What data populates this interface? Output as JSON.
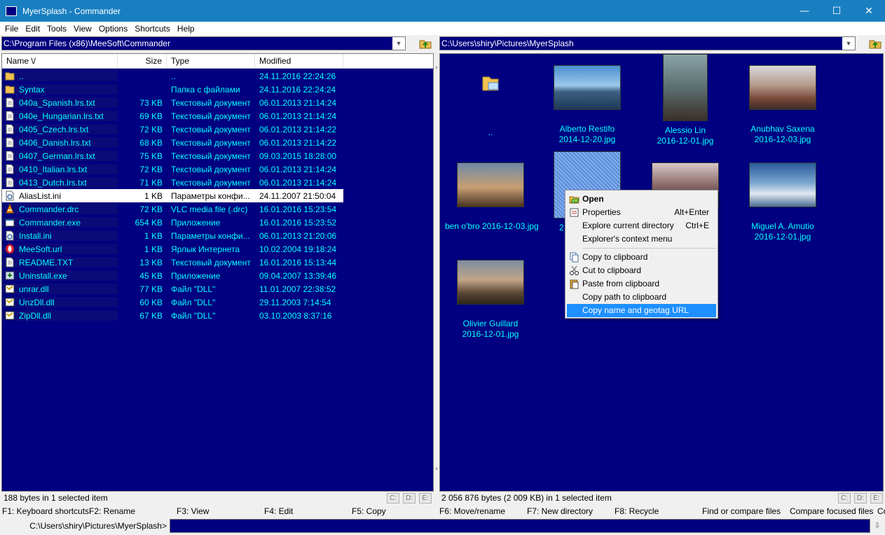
{
  "window": {
    "title": "MyerSplash - Commander",
    "minimize": "—",
    "maximize": "☐",
    "close": "✕"
  },
  "menu": [
    "File",
    "Edit",
    "Tools",
    "View",
    "Options",
    "Shortcuts",
    "Help"
  ],
  "left": {
    "path": "C:\\Program Files (x86)\\MeeSoft\\Commander",
    "columns": {
      "name": "Name \\/",
      "size": "Size",
      "type": "Type",
      "modified": "Modified"
    },
    "rows": [
      {
        "icon": "folder-up-icon",
        "name": "..",
        "size": "",
        "type": "..",
        "modified": "24.11.2016 22:24:26"
      },
      {
        "icon": "folder-icon",
        "name": "Syntax",
        "size": "",
        "type": "Папка с файлами",
        "modified": "24.11.2016 22:24:24"
      },
      {
        "icon": "text-file-icon",
        "name": "040a_Spanish.lrs.txt",
        "size": "73 KB",
        "type": "Текстовый документ",
        "modified": "06.01.2013 21:14:24"
      },
      {
        "icon": "text-file-icon",
        "name": "040e_Hungarian.lrs.txt",
        "size": "69 KB",
        "type": "Текстовый документ",
        "modified": "06.01.2013 21:14:24"
      },
      {
        "icon": "text-file-icon",
        "name": "0405_Czech.lrs.txt",
        "size": "72 KB",
        "type": "Текстовый документ",
        "modified": "06.01.2013 21:14:22"
      },
      {
        "icon": "text-file-icon",
        "name": "0406_Danish.lrs.txt",
        "size": "68 KB",
        "type": "Текстовый документ",
        "modified": "06.01.2013 21:14:22"
      },
      {
        "icon": "text-file-icon",
        "name": "0407_German.lrs.txt",
        "size": "75 KB",
        "type": "Текстовый документ",
        "modified": "09.03.2015 18:28:00"
      },
      {
        "icon": "text-file-icon",
        "name": "0410_Italian.lrs.txt",
        "size": "72 KB",
        "type": "Текстовый документ",
        "modified": "06.01.2013 21:14:24"
      },
      {
        "icon": "text-file-icon",
        "name": "0413_Dutch.lrs.txt",
        "size": "71 KB",
        "type": "Текстовый документ",
        "modified": "06.01.2013 21:14:24"
      },
      {
        "icon": "ini-file-icon",
        "name": "AliasList.ini",
        "size": "1 KB",
        "type": "Параметры конфи...",
        "modified": "24.11.2007 21:50:04",
        "selected": true
      },
      {
        "icon": "vlc-cone-icon",
        "name": "Commander.drc",
        "size": "72 KB",
        "type": "VLC media file (.drc)",
        "modified": "16.01.2016 15:23:54"
      },
      {
        "icon": "exe-icon",
        "name": "Commander.exe",
        "size": "654 KB",
        "type": "Приложение",
        "modified": "16.01.2016 15:23:52"
      },
      {
        "icon": "ini-file-icon",
        "name": "Install.ini",
        "size": "1 KB",
        "type": "Параметры конфи...",
        "modified": "06.01.2013 21:20:06"
      },
      {
        "icon": "opera-icon",
        "name": "MeeSoft.url",
        "size": "1 KB",
        "type": "Ярлык Интернета",
        "modified": "10.02.2004 19:18:24"
      },
      {
        "icon": "text-file-icon",
        "name": "README.TXT",
        "size": "13 KB",
        "type": "Текстовый документ",
        "modified": "16.01.2016 15:13:44"
      },
      {
        "icon": "installer-icon",
        "name": "Uninstall.exe",
        "size": "45 KB",
        "type": "Приложение",
        "modified": "09.04.2007 13:39:46"
      },
      {
        "icon": "dll-icon",
        "name": "unrar.dll",
        "size": "77 KB",
        "type": "Файл \"DLL\"",
        "modified": "11.01.2007 22:38:52"
      },
      {
        "icon": "dll-icon",
        "name": "UnzDll.dll",
        "size": "60 KB",
        "type": "Файл \"DLL\"",
        "modified": "29.11.2003 7:14:54"
      },
      {
        "icon": "dll-icon",
        "name": "ZipDll.dll",
        "size": "67 KB",
        "type": "Файл \"DLL\"",
        "modified": "03.10.2003 8:37:16"
      }
    ],
    "status": "188 bytes in 1 selected item",
    "drives": [
      "C:",
      "D:",
      "E:"
    ]
  },
  "right": {
    "path": "C:\\Users\\shiry\\Pictures\\MyerSplash",
    "thumbnails": [
      {
        "line1": "..",
        "line2": ""
      },
      {
        "line1": "Alberto Restifo",
        "line2": "2014-12-20.jpg"
      },
      {
        "line1": "Alessio Lin",
        "line2": "2016-12-01.jpg"
      },
      {
        "line1": "Anubhav Saxena",
        "line2": "2016-12-03.jpg"
      },
      {
        "line1": "ben o'bro  2016-12-03.jpg",
        "line2": ""
      },
      {
        "line1": "2",
        "line2": ""
      },
      {
        "line1": "",
        "line2": ""
      },
      {
        "line1": "Miguel A. Amutio",
        "line2": "2016-12-01.jpg"
      },
      {
        "line1": "Olivier Guillard",
        "line2": "2016-12-01.jpg"
      }
    ],
    "status": "2 056 876 bytes (2 009 KB) in 1 selected item",
    "drives": [
      "C:",
      "D:",
      "E:"
    ]
  },
  "context_menu": {
    "items": [
      {
        "label": "Open",
        "shortcut": ""
      },
      {
        "label": "Properties",
        "shortcut": "Alt+Enter"
      },
      {
        "label": "Explore current directory",
        "shortcut": "Ctrl+E"
      },
      {
        "label": "Explorer's context menu",
        "shortcut": ""
      },
      {
        "label": "Copy to clipboard",
        "shortcut": ""
      },
      {
        "label": "Cut to clipboard",
        "shortcut": ""
      },
      {
        "label": "Paste from clipboard",
        "shortcut": ""
      },
      {
        "label": "Copy path to clipboard",
        "shortcut": ""
      },
      {
        "label": "Copy name and geotag URL",
        "shortcut": ""
      }
    ]
  },
  "fkeys": [
    "F1: Keyboard shortcuts",
    "F2: Rename",
    "F3: View",
    "F4: Edit",
    "F5: Copy",
    "F6: Move/rename",
    "F7: New directory",
    "F8: Recycle",
    "Find or compare files",
    "Compare focused files",
    "Co"
  ],
  "command": {
    "path": "C:\\Users\\shiry\\Pictures\\MyerSplash>",
    "value": ""
  },
  "colors": {
    "panel_bg": "#000080",
    "text": "#00ffff",
    "titlebar": "#1a7fc1",
    "highlight": "#1e90ff"
  }
}
